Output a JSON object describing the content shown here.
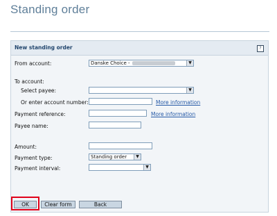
{
  "page": {
    "title": "Standing order"
  },
  "panel": {
    "title": "New standing order",
    "help_icon": "?"
  },
  "form": {
    "from_account": {
      "label": "From account:",
      "value": "Danske Choice -",
      "arrow": "▼"
    },
    "to_account": {
      "label": "To account:"
    },
    "select_payee": {
      "label": "Select payee:",
      "value": "",
      "arrow": "▼"
    },
    "account_number": {
      "label": "Or enter account number:",
      "value": "",
      "more_info": "More information"
    },
    "payment_reference": {
      "label": "Payment reference:",
      "value": "",
      "more_info": "More information"
    },
    "payee_name": {
      "label": "Payee name:",
      "value": ""
    },
    "amount": {
      "label": "Amount:",
      "value": ""
    },
    "payment_type": {
      "label": "Payment type:",
      "value": "Standing order",
      "arrow": "▼"
    },
    "payment_interval": {
      "label": "Payment interval:",
      "value": "",
      "arrow": "▼"
    }
  },
  "buttons": {
    "ok": "OK",
    "clear": "Clear form",
    "back": "Back"
  }
}
